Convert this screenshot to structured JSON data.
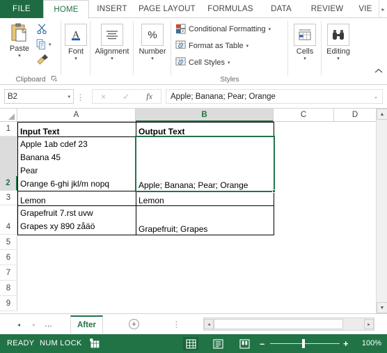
{
  "ribbon": {
    "tabs": [
      {
        "label": "FILE",
        "active": false,
        "file": true
      },
      {
        "label": "HOME",
        "active": true
      },
      {
        "label": "INSERT",
        "active": false
      },
      {
        "label": "PAGE LAYOUT",
        "active": false
      },
      {
        "label": "FORMULAS",
        "active": false
      },
      {
        "label": "DATA",
        "active": false
      },
      {
        "label": "REVIEW",
        "active": false
      },
      {
        "label": "VIE",
        "active": false
      }
    ],
    "scroll_right_icon": "▸",
    "groups": {
      "clipboard": {
        "label": "Clipboard",
        "paste_label": "Paste",
        "paste_caret": "▾",
        "cut_icon": "scissors-icon",
        "copy_icon": "copy-icon",
        "copy_caret": "▾",
        "format_painter_icon": "format-painter-icon",
        "dialog_launcher": "⤡"
      },
      "font": {
        "label": "Font",
        "caret": "▾"
      },
      "alignment": {
        "label": "Alignment",
        "caret": "▾"
      },
      "number": {
        "label": "Number",
        "symbol": "%",
        "caret": "▾"
      },
      "styles": {
        "label": "Styles",
        "items": [
          {
            "label": "Conditional Formatting",
            "caret": "▾"
          },
          {
            "label": "Format as Table",
            "caret": "▾"
          },
          {
            "label": "Cell Styles",
            "caret": "▾"
          }
        ]
      },
      "cells": {
        "label": "Cells",
        "caret": "▾"
      },
      "editing": {
        "label": "Editing",
        "caret": "▾"
      }
    },
    "collapse_icon": "⌃"
  },
  "formula_bar": {
    "name_box_value": "B2",
    "name_box_caret": "▾",
    "cancel_icon": "×",
    "enter_icon": "✓",
    "function_icon": "fx",
    "formula_value": "Apple; Banana; Pear; Orange",
    "expand_caret": "⌄"
  },
  "grid": {
    "column_headers": [
      "A",
      "B",
      "C",
      "D"
    ],
    "selected_column": "B",
    "row_headers": [
      "1",
      "2",
      "3",
      "4",
      "5",
      "6",
      "7",
      "8",
      "9"
    ],
    "selected_row": "2",
    "selected_cell": "B2",
    "rows": [
      {
        "row": "1",
        "a": "Input Text",
        "b": "Output Text"
      },
      {
        "row": "2",
        "a": "Apple 1ab cdef 23\nBanana 45\nPear\nOrange 6-ghi jkl/m nopq",
        "b": "Apple; Banana; Pear; Orange"
      },
      {
        "row": "3",
        "a": "Lemon",
        "b": "Lemon"
      },
      {
        "row": "4",
        "a": "Grapefruit 7.rst uvw\nGrapes xy 890 zåäö",
        "b": "Grapefruit; Grapes"
      },
      {
        "row": "5",
        "a": "",
        "b": ""
      },
      {
        "row": "6",
        "a": "",
        "b": ""
      },
      {
        "row": "7",
        "a": "",
        "b": ""
      },
      {
        "row": "8",
        "a": "",
        "b": ""
      },
      {
        "row": "9",
        "a": "",
        "b": ""
      }
    ],
    "scroll_up_icon": "▲",
    "scroll_down_icon": "▼"
  },
  "sheet_bar": {
    "first_icon": "◂",
    "last_icon": "▸",
    "ellipsis": "…",
    "tabs": [
      {
        "label": "After",
        "active": true
      }
    ],
    "add_sheet_icon": "+",
    "handle_dots": "⋮",
    "hscroll_left_icon": "◂",
    "hscroll_right_icon": "▸"
  },
  "status_bar": {
    "mode": "READY",
    "num_lock": "NUM LOCK",
    "macro_icon": "macro-record-icon",
    "views": [
      {
        "name": "normal-view",
        "icon": "▦",
        "active": true
      },
      {
        "name": "page-layout-view",
        "icon": "▤",
        "active": false
      },
      {
        "name": "page-break-view",
        "icon": "▥",
        "active": false
      }
    ],
    "zoom_out_icon": "–",
    "zoom_in_icon": "+",
    "zoom_level": "100%"
  },
  "colors": {
    "excel_green": "#217346",
    "file_tab_green": "#1e6b43",
    "header_select_gray": "#dcdcdc"
  }
}
